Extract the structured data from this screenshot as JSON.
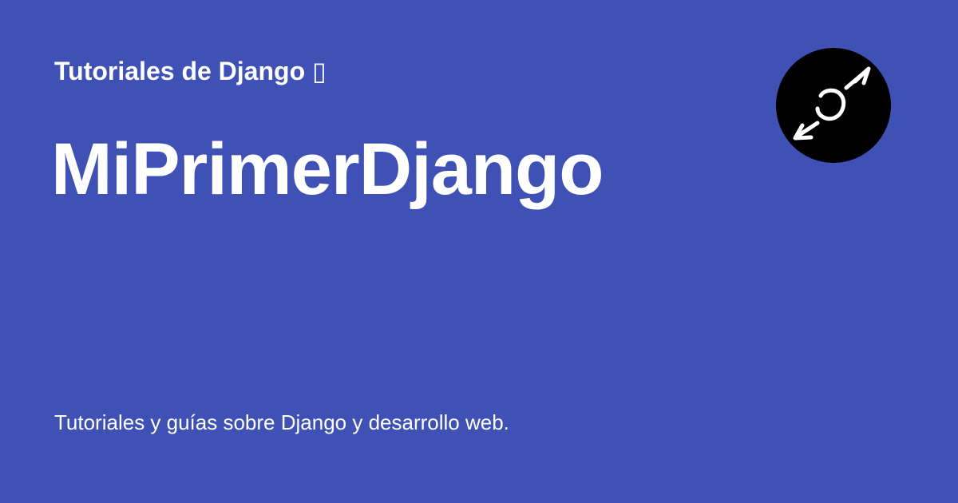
{
  "card": {
    "site_name": "Tutoriales de Django ▯",
    "title": "MiPrimerDjango",
    "description": "Tutoriales y guías sobre Django y desarrollo web.",
    "logo_icon": "compass-logo-icon",
    "colors": {
      "background": "#3f51b5",
      "text": "#ffffff",
      "logo_background": "#000000"
    }
  }
}
